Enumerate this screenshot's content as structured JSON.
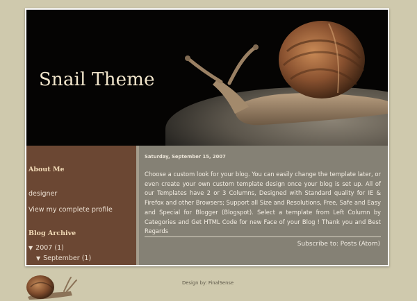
{
  "header": {
    "title": "Snail Theme"
  },
  "sidebar": {
    "about": {
      "heading": "About Me",
      "name": "designer",
      "profile_link": "View my complete profile"
    },
    "archive": {
      "heading": "Blog Archive",
      "year": {
        "label": "2007",
        "count": "(1)"
      },
      "month": {
        "label": "September",
        "count": "(1)"
      }
    }
  },
  "main": {
    "date": "Saturday, September 15, 2007",
    "post_body": "Choose a custom look for your blog. You can easily change the template later, or even create your own custom template design once your blog is set up. All of our Templates have 2 or 3 Columns, Designed with Standard quality for IE & Firefox and other Browsers; Support all Size and Resolutions, Free, Safe and Easy and Special for Blogger (Blogspot). Select a template from Left Column by Categories and Get HTML Code for new Face of your Blog ! Thank you and Best Regards",
    "subscribe_label": "Subscribe to:",
    "subscribe_link": "Posts (Atom)"
  },
  "footer": {
    "credit": "Design by: FinalSense"
  },
  "colors": {
    "background": "#cfc9ad",
    "sidebar": "#6b4733",
    "main": "#858175",
    "header": "#050403",
    "title": "#f2e6cc"
  },
  "icons": {
    "triangle": "triangle-down-icon"
  }
}
